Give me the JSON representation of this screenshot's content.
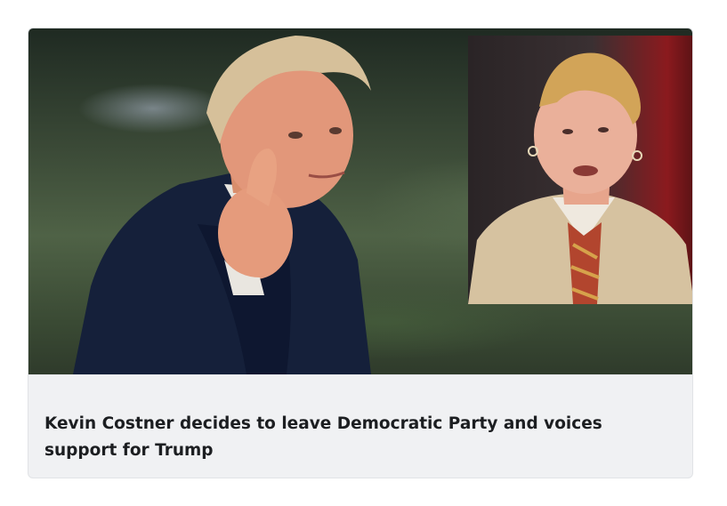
{
  "article": {
    "headline": "Kevin Costner decides to leave Democratic Party and voices support for Trump",
    "image": {
      "main_subject": "man-giving-thumbs-up",
      "inset_subject": "man-with-spiked-blond-hair"
    }
  },
  "colors": {
    "caption_background": "#f0f1f3",
    "headline_text": "#1c1e21",
    "card_border": "#e1e3e6"
  }
}
